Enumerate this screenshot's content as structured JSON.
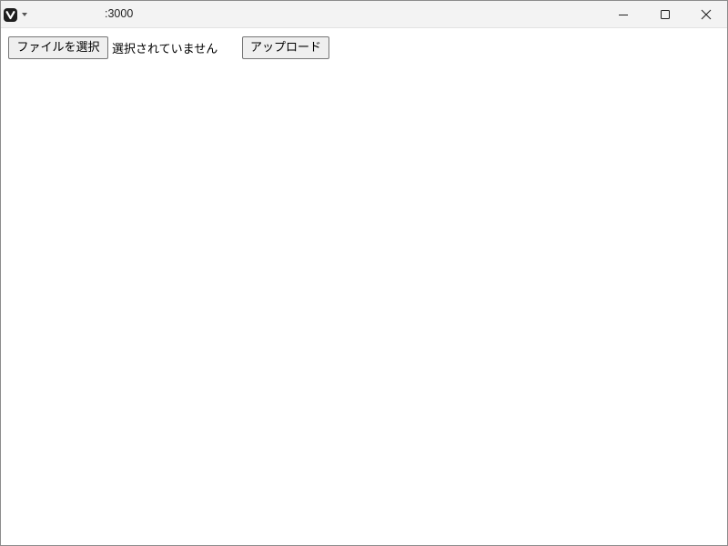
{
  "window": {
    "title": ":3000",
    "controls": {
      "minimize": "minimize-icon",
      "maximize": "maximize-icon",
      "close": "close-icon"
    },
    "app_icon": "vivaldi-logo-icon"
  },
  "form": {
    "choose_file_label": "ファイルを選択",
    "file_status": "選択されていません",
    "upload_label": "アップロード"
  },
  "colors": {
    "titlebar_bg": "#f3f3f3",
    "button_bg": "#efefef",
    "button_border": "#767676"
  }
}
